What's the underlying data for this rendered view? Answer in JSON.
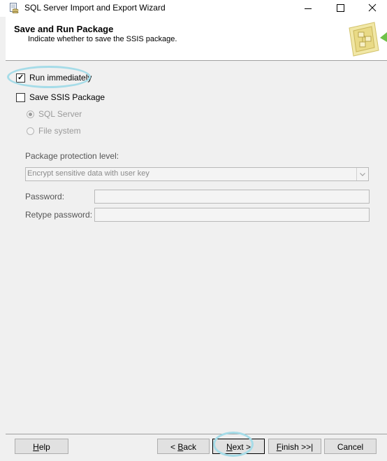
{
  "window": {
    "title": "SQL Server Import and Export Wizard"
  },
  "header": {
    "title": "Save and Run Package",
    "subtitle": "Indicate whether to save the SSIS package."
  },
  "options": {
    "run_immediately": {
      "label": "Run immediately",
      "checked": true
    },
    "save_ssis": {
      "label": "Save SSIS Package",
      "checked": false
    },
    "location_radios": [
      {
        "label": "SQL Server",
        "selected": true,
        "enabled": false
      },
      {
        "label": "File system",
        "selected": false,
        "enabled": false
      }
    ]
  },
  "protection": {
    "label": "Package protection level:",
    "selected_value": "Encrypt sensitive data with user key"
  },
  "password": {
    "label": "Password:",
    "value": ""
  },
  "retype_password": {
    "label": "Retype password:",
    "value": ""
  },
  "buttons": {
    "help": {
      "accel": "H",
      "rest": "elp"
    },
    "back": {
      "prefix": "< ",
      "accel": "B",
      "rest": "ack"
    },
    "next": {
      "accel": "N",
      "rest": "ext >"
    },
    "finish": {
      "accel": "F",
      "rest": "inish >>|"
    },
    "cancel": "Cancel"
  },
  "colors": {
    "highlight": "#a6dce8",
    "disabled_text": "#9a9a9a",
    "header_background": "#ffffff",
    "body_background": "#f0f0f0"
  },
  "icons": [
    "app-icon",
    "minimize-icon",
    "maximize-icon",
    "close-icon",
    "wizard-header-graphic",
    "dropdown-arrow-icon",
    "checkmark-icon"
  ]
}
